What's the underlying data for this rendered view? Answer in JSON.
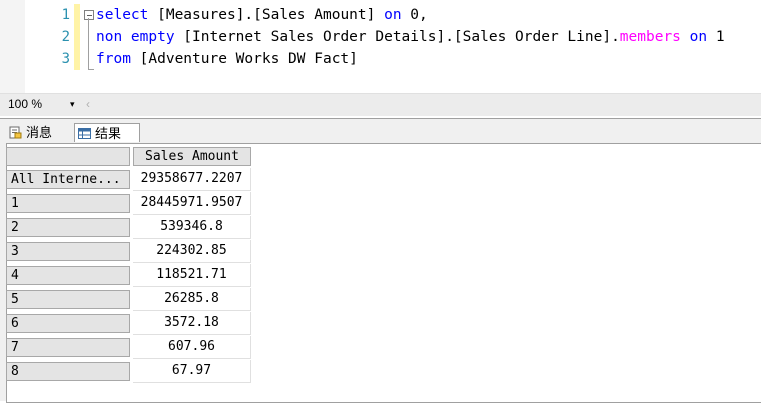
{
  "editor": {
    "line_numbers": [
      "1",
      "2",
      "3"
    ],
    "line1": {
      "kw1": "select",
      "t1": " [Measures].[Sales Amount] ",
      "kw2": "on",
      "t2": " 0,"
    },
    "line2": {
      "kw1": "non empty",
      "t1": " [Internet Sales Order Details].[Sales Order Line].",
      "fn": "members",
      "t2": " ",
      "kw2": "on",
      "t3": " 1"
    },
    "line3": {
      "kw1": "from",
      "t1": " [Adventure Works DW Fact]"
    }
  },
  "zoombar": {
    "zoom": "100 %",
    "arrow": "▾",
    "scroll_left": "‹"
  },
  "tabs": {
    "messages": "消息",
    "results": "结果"
  },
  "grid": {
    "column_header": "Sales Amount",
    "rows": [
      {
        "label": "All Interne...",
        "value": "29358677.2207"
      },
      {
        "label": "1",
        "value": "28445971.9507"
      },
      {
        "label": "2",
        "value": "539346.8"
      },
      {
        "label": "3",
        "value": "224302.85"
      },
      {
        "label": "4",
        "value": "118521.71"
      },
      {
        "label": "5",
        "value": "26285.8"
      },
      {
        "label": "6",
        "value": "3572.18"
      },
      {
        "label": "7",
        "value": "607.96"
      },
      {
        "label": "8",
        "value": "67.97"
      }
    ]
  },
  "colors": {
    "keyword": "#0000ff",
    "function": "#ff00ff",
    "line_number": "#2b91af",
    "header_bg": "#e4e4e4"
  }
}
